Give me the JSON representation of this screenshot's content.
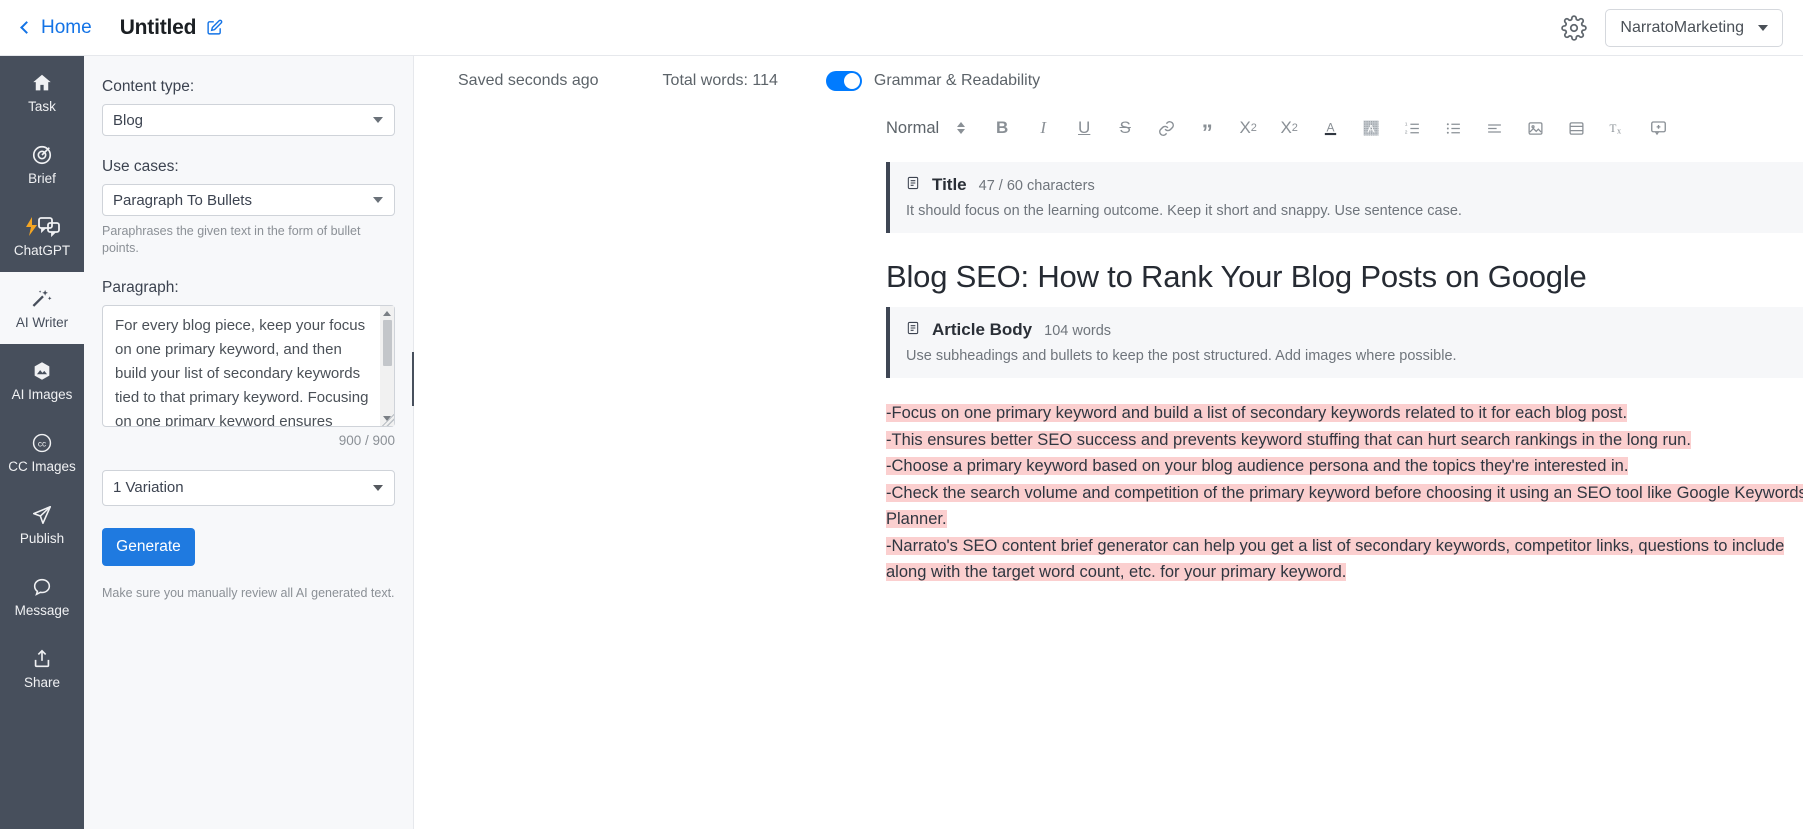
{
  "topbar": {
    "back_label": "Home",
    "doc_title": "Untitled",
    "edit_icon": "edit-pencil-icon",
    "gear_icon": "gear-icon",
    "workspace": "NarratoMarketing"
  },
  "rail": {
    "items": [
      {
        "label": "Task",
        "icon": "home-icon",
        "active": false
      },
      {
        "label": "Brief",
        "icon": "target-icon",
        "active": false
      },
      {
        "label": "ChatGPT",
        "icon": "chat-bolt-icon",
        "active": false
      },
      {
        "label": "AI Writer",
        "icon": "magic-wand-icon",
        "active": true
      },
      {
        "label": "AI Images",
        "icon": "image-icon",
        "active": false
      },
      {
        "label": "CC Images",
        "icon": "creative-commons-icon",
        "active": false
      },
      {
        "label": "Publish",
        "icon": "paper-plane-icon",
        "active": false
      },
      {
        "label": "Message",
        "icon": "chat-bubble-icon",
        "active": false
      },
      {
        "label": "Share",
        "icon": "share-upload-icon",
        "active": false
      }
    ]
  },
  "panel": {
    "content_type_label": "Content type:",
    "content_type_value": "Blog",
    "use_cases_label": "Use cases:",
    "use_cases_value": "Paragraph To Bullets",
    "use_cases_hint": "Paraphrases the given text in the form of bullet points.",
    "paragraph_label": "Paragraph:",
    "paragraph_value": "For every blog piece, keep your focus on one primary keyword, and then build your list of secondary keywords tied to that primary keyword. Focusing on one primary keyword ensures better SEO success",
    "char_counter": "900 / 900",
    "variation_value": "1 Variation",
    "generate_label": "Generate",
    "review_note": "Make sure you manually review all AI generated text.",
    "collapse_icon": "chevron-left-icon"
  },
  "editor": {
    "status_saved": "Saved seconds ago",
    "status_words": "Total words: 114",
    "grammar_label": "Grammar & Readability",
    "grammar_enabled": true,
    "toolbar": {
      "style_value": "Normal",
      "items": [
        {
          "name": "bold-icon",
          "glyph": "B"
        },
        {
          "name": "italic-icon",
          "glyph": "I"
        },
        {
          "name": "underline-icon",
          "glyph": "U"
        },
        {
          "name": "strikethrough-icon",
          "glyph": "S"
        },
        {
          "name": "link-icon",
          "glyph": "🔗"
        },
        {
          "name": "blockquote-icon",
          "glyph": "”"
        },
        {
          "name": "subscript-icon",
          "glyph": "X₂"
        },
        {
          "name": "superscript-icon",
          "glyph": "X²"
        },
        {
          "name": "text-color-icon",
          "glyph": "A"
        },
        {
          "name": "highlight-color-icon",
          "glyph": "A"
        },
        {
          "name": "ordered-list-icon",
          "glyph": "≡"
        },
        {
          "name": "bullet-list-icon",
          "glyph": "≡"
        },
        {
          "name": "align-icon",
          "glyph": "≡"
        },
        {
          "name": "insert-image-icon",
          "glyph": "▣"
        },
        {
          "name": "insert-video-icon",
          "glyph": "▤"
        },
        {
          "name": "clear-formatting-icon",
          "glyph": "Tx"
        },
        {
          "name": "add-comment-icon",
          "glyph": "💬"
        }
      ]
    },
    "title_card": {
      "icon": "document-section-icon",
      "title": "Title",
      "meta": "47 / 60 characters",
      "sub": "It should focus on the learning outcome. Keep it short and snappy. Use sentence case."
    },
    "document_heading": "Blog SEO: How to Rank Your Blog Posts on Google",
    "body_card": {
      "icon": "document-section-icon",
      "title": "Article Body",
      "meta": "104 words",
      "sub": "Use subheadings and bullets to keep the post structured. Add images where possible."
    },
    "body_lines": [
      "-Focus on one primary keyword and build a list of secondary keywords related to it for each blog post.",
      "-This ensures better SEO success and prevents keyword stuffing that can hurt search rankings in the long run.",
      "-Choose a primary keyword based on your blog audience persona and the topics they're interested in.",
      "-Check the search volume and competition of the primary keyword before choosing it using an SEO tool like Google Keywords Planner.",
      "-Narrato's SEO content brief generator can help you get a list of secondary keywords, competitor links, questions to include along with the target word count, etc. for your primary keyword."
    ]
  },
  "colors": {
    "accent_blue": "#1f7ae0",
    "link_blue": "#1373e6",
    "rail_dark": "#474f5c",
    "highlight_pink": "#fbcfcf",
    "toggle_on": "#007bff"
  }
}
